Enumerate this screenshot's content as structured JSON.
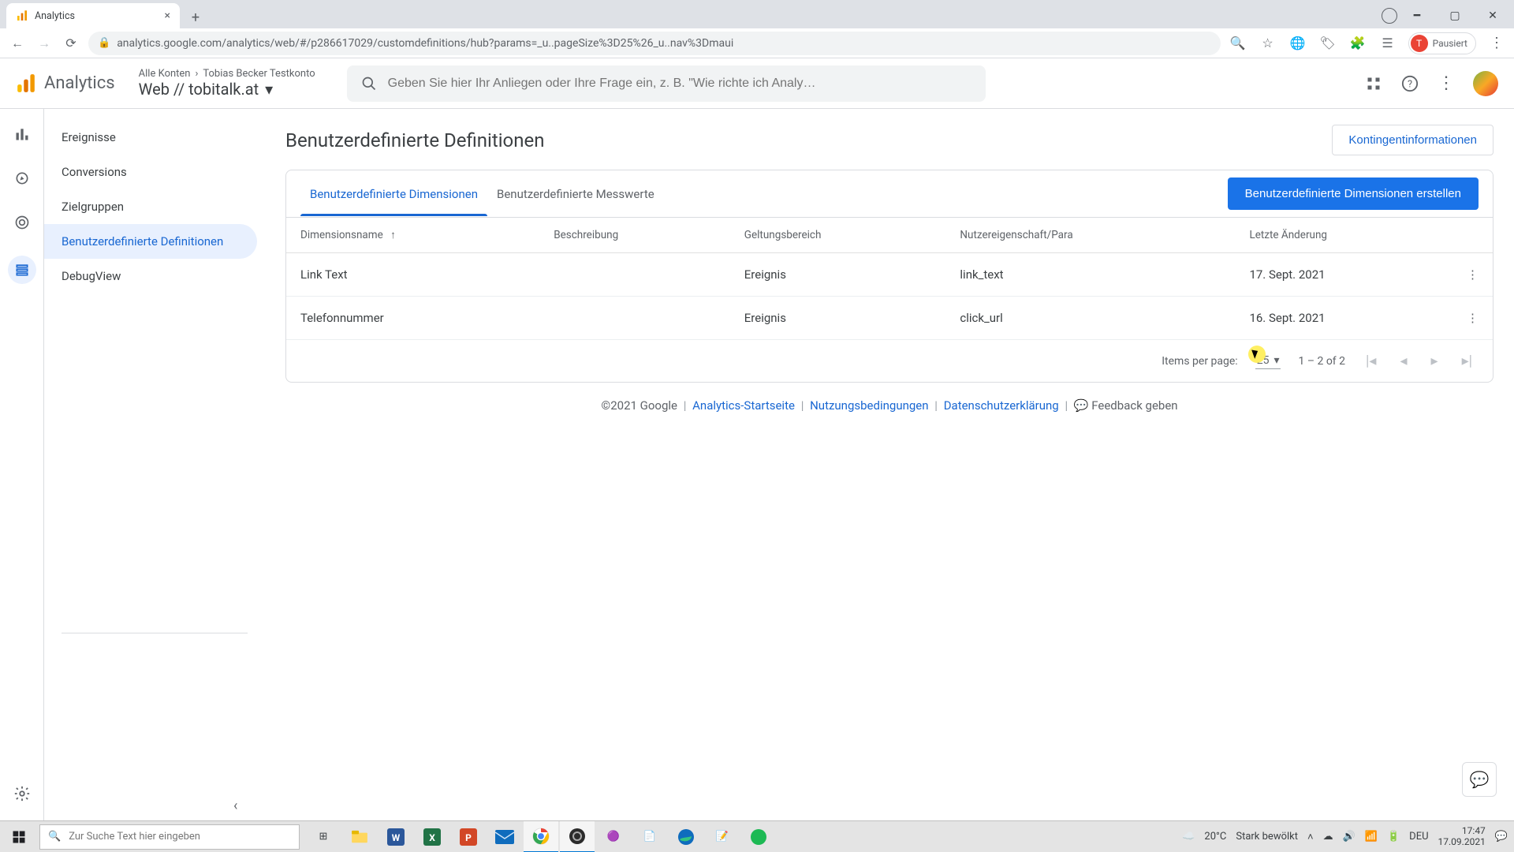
{
  "browser": {
    "tab_title": "Analytics",
    "url": "analytics.google.com/analytics/web/#/p286617029/customdefinitions/hub?params=_u..pageSize%3D25%26_u..nav%3Dmaui",
    "profile_status": "Pausiert",
    "profile_initial": "T"
  },
  "ga": {
    "product": "Analytics",
    "context_line1_a": "Alle Konten",
    "context_line1_b": "Tobias Becker Testkonto",
    "context_line2": "Web // tobitalk.at",
    "search_placeholder": "Geben Sie hier Ihr Anliegen oder Ihre Frage ein, z. B. \"Wie richte ich Analy…"
  },
  "sidenav": {
    "items": [
      "Ereignisse",
      "Conversions",
      "Zielgruppen",
      "Benutzerdefinierte Definitionen",
      "DebugView"
    ],
    "active_index": 3
  },
  "page": {
    "title": "Benutzerdefinierte Definitionen",
    "quota_btn": "Kontingentinformationen",
    "tabs": [
      "Benutzerdefinierte Dimensionen",
      "Benutzerdefinierte Messwerte"
    ],
    "active_tab": 0,
    "create_btn": "Benutzerdefinierte Dimensionen erstellen",
    "columns": {
      "name": "Dimensionsname",
      "desc": "Beschreibung",
      "scope": "Geltungsbereich",
      "prop": "Nutzereigenschaft/Para",
      "changed": "Letzte Änderung"
    },
    "rows": [
      {
        "name": "Link Text",
        "desc": "",
        "scope": "Ereignis",
        "prop": "link_text",
        "changed": "17. Sept. 2021"
      },
      {
        "name": "Telefonnummer",
        "desc": "",
        "scope": "Ereignis",
        "prop": "click_url",
        "changed": "16. Sept. 2021"
      }
    ],
    "pager": {
      "items_per_page_label": "Items per page:",
      "items_per_page_value": "25",
      "range": "1 – 2 of 2"
    }
  },
  "footer": {
    "copyright": "©2021 Google",
    "links": [
      "Analytics-Startseite",
      "Nutzungsbedingungen",
      "Datenschutzerklärung"
    ],
    "feedback": "Feedback geben"
  },
  "taskbar": {
    "search_placeholder": "Zur Suche Text hier eingeben",
    "weather_temp": "20°C",
    "weather_text": "Stark bewölkt",
    "lang": "DEU",
    "time": "17:47",
    "date": "17.09.2021"
  }
}
